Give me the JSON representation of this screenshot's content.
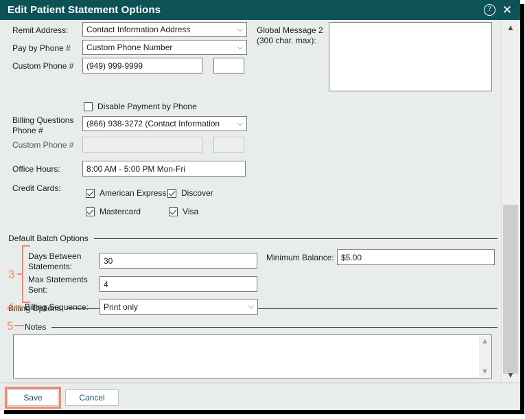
{
  "window": {
    "title": "Edit Patient Statement Options",
    "help_icon": "help-circle-icon",
    "close_icon": "close-icon"
  },
  "form": {
    "remit_address": {
      "label": "Remit Address:",
      "value": "Contact Information Address"
    },
    "pay_by_phone": {
      "label": "Pay by Phone #",
      "value": "Custom Phone Number"
    },
    "custom_phone_1": {
      "label": "Custom Phone #",
      "value": "(949) 999-9999",
      "ext_value": ""
    },
    "disable_payment_by_phone": {
      "label": "Disable Payment by Phone",
      "checked": false
    },
    "billing_questions_phone": {
      "label": "Billing Questions Phone #",
      "label_line1": "Billing Questions",
      "label_line2": "Phone #",
      "value": "(866) 938-3272 (Contact Information"
    },
    "custom_phone_2": {
      "label": "Custom Phone #",
      "value": "",
      "ext_value": "",
      "disabled": true
    },
    "office_hours": {
      "label": "Office Hours:",
      "value": "8:00 AM - 5:00 PM Mon-Fri"
    },
    "credit_cards": {
      "label": "Credit Cards:",
      "items": [
        {
          "label": "American Express",
          "checked": true
        },
        {
          "label": "Discover",
          "checked": true
        },
        {
          "label": "Mastercard",
          "checked": true
        },
        {
          "label": "Visa",
          "checked": true
        }
      ]
    },
    "global_message_2": {
      "label_line1": "Global Message 2",
      "label_line2": "(300 char. max):",
      "value": ""
    }
  },
  "default_batch_options": {
    "group_title": "Default Batch Options",
    "days_between_statements": {
      "label_line1": "Days Between",
      "label_line2": "Statements:",
      "value": "30"
    },
    "max_statements_sent": {
      "label_line1": "Max Statements",
      "label_line2": "Sent:",
      "value": "4"
    },
    "minimum_balance": {
      "label": "Minimum Balance:",
      "value": "$5.00"
    }
  },
  "billing_options": {
    "group_title": "Billing Options",
    "billing_sequence": {
      "label": "Billing Sequence:",
      "value": "Print only"
    }
  },
  "notes": {
    "group_title": "Notes",
    "value": ""
  },
  "footer": {
    "save_label": "Save",
    "cancel_label": "Cancel"
  },
  "annotations": {
    "batch_marker": "3",
    "billing_marker": "4",
    "notes_marker": "5",
    "accent_color": "#f4876a"
  },
  "scrollbar": {
    "up_icon": "chevron-up-icon",
    "down_icon": "chevron-down-icon"
  }
}
